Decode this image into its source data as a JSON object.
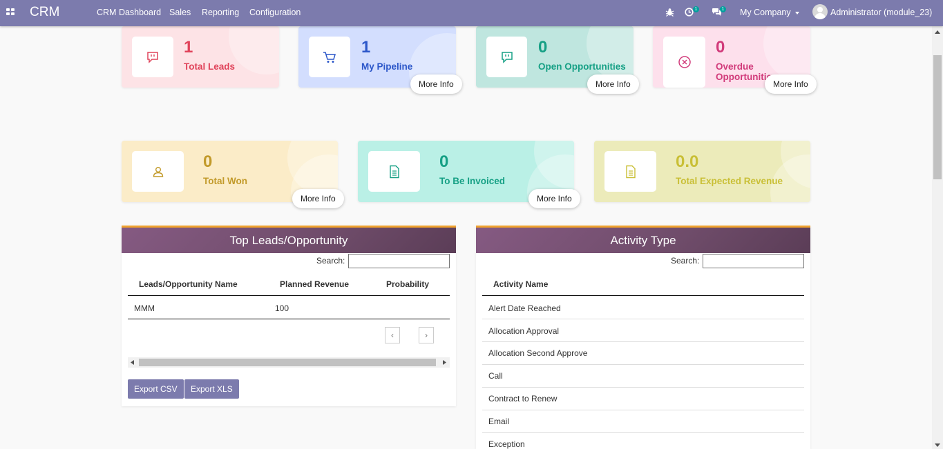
{
  "navbar": {
    "app_name": "CRM",
    "menu": [
      "CRM Dashboard",
      "Sales",
      "Reporting",
      "Configuration"
    ],
    "activity_count": "1",
    "messages_count": "1",
    "company": "My Company",
    "user": "Administrator (module_23)"
  },
  "tiles": {
    "total_leads": {
      "value": "1",
      "label": "Total Leads"
    },
    "my_pipeline": {
      "value": "1",
      "label": "My Pipeline",
      "more": "More Info"
    },
    "open_opportunities": {
      "value": "0",
      "label": "Open Opportunities",
      "more": "More Info"
    },
    "overdue_opportunities": {
      "value": "0",
      "label": "Overdue Opportunities",
      "more": "More Info"
    },
    "total_won": {
      "value": "0",
      "label": "Total Won",
      "more": "More Info"
    },
    "to_be_invoiced": {
      "value": "0",
      "label": "To Be Invoiced",
      "more": "More Info"
    },
    "total_expected_revenue": {
      "value": "0.0",
      "label": "Total Expected Revenue"
    }
  },
  "top_leads": {
    "title": "Top Leads/Opportunity",
    "search_label": "Search:",
    "columns": [
      "Leads/Opportunity Name",
      "Planned Revenue",
      "Probability"
    ],
    "rows": [
      [
        "MMM",
        "100",
        ""
      ]
    ],
    "prev": "‹",
    "next": "›",
    "export_csv": "Export CSV",
    "export_xls": "Export XLS"
  },
  "activity_type": {
    "title": "Activity Type",
    "search_label": "Search:",
    "column": "Activity Name",
    "rows": [
      "Alert Date Reached",
      "Allocation Approval",
      "Allocation Second Approve",
      "Call",
      "Contract to Renew",
      "Email",
      "Exception"
    ]
  },
  "colors": {
    "navbar": "#7c7bad",
    "accent_bar": "#f0a22d",
    "panel_header": "#6f4c6a",
    "button": "#7c7bad"
  }
}
